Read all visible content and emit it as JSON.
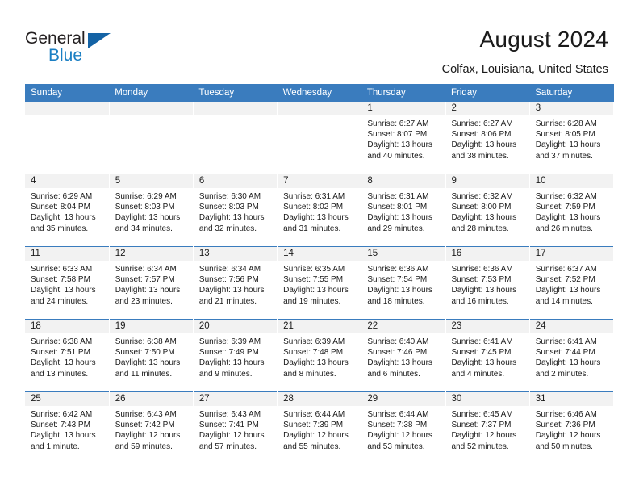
{
  "brand": {
    "name_part1": "General",
    "name_part2": "Blue",
    "logo_icon": "triangle-logo-icon"
  },
  "header": {
    "title": "August 2024",
    "subtitle": "Colfax, Louisiana, United States"
  },
  "colors": {
    "header_blue": "#3a7cbe",
    "brand_blue": "#1b7fc3",
    "logo_blue": "#1463a5",
    "daynum_band": "#f2f2f2",
    "text": "#1a1a1a"
  },
  "calendar": {
    "weekday_headers": [
      "Sunday",
      "Monday",
      "Tuesday",
      "Wednesday",
      "Thursday",
      "Friday",
      "Saturday"
    ],
    "weeks": [
      [
        {
          "empty": true
        },
        {
          "empty": true
        },
        {
          "empty": true
        },
        {
          "empty": true
        },
        {
          "day": "1",
          "sunrise": "Sunrise: 6:27 AM",
          "sunset": "Sunset: 8:07 PM",
          "daylight1": "Daylight: 13 hours",
          "daylight2": "and 40 minutes."
        },
        {
          "day": "2",
          "sunrise": "Sunrise: 6:27 AM",
          "sunset": "Sunset: 8:06 PM",
          "daylight1": "Daylight: 13 hours",
          "daylight2": "and 38 minutes."
        },
        {
          "day": "3",
          "sunrise": "Sunrise: 6:28 AM",
          "sunset": "Sunset: 8:05 PM",
          "daylight1": "Daylight: 13 hours",
          "daylight2": "and 37 minutes."
        }
      ],
      [
        {
          "day": "4",
          "sunrise": "Sunrise: 6:29 AM",
          "sunset": "Sunset: 8:04 PM",
          "daylight1": "Daylight: 13 hours",
          "daylight2": "and 35 minutes."
        },
        {
          "day": "5",
          "sunrise": "Sunrise: 6:29 AM",
          "sunset": "Sunset: 8:03 PM",
          "daylight1": "Daylight: 13 hours",
          "daylight2": "and 34 minutes."
        },
        {
          "day": "6",
          "sunrise": "Sunrise: 6:30 AM",
          "sunset": "Sunset: 8:03 PM",
          "daylight1": "Daylight: 13 hours",
          "daylight2": "and 32 minutes."
        },
        {
          "day": "7",
          "sunrise": "Sunrise: 6:31 AM",
          "sunset": "Sunset: 8:02 PM",
          "daylight1": "Daylight: 13 hours",
          "daylight2": "and 31 minutes."
        },
        {
          "day": "8",
          "sunrise": "Sunrise: 6:31 AM",
          "sunset": "Sunset: 8:01 PM",
          "daylight1": "Daylight: 13 hours",
          "daylight2": "and 29 minutes."
        },
        {
          "day": "9",
          "sunrise": "Sunrise: 6:32 AM",
          "sunset": "Sunset: 8:00 PM",
          "daylight1": "Daylight: 13 hours",
          "daylight2": "and 28 minutes."
        },
        {
          "day": "10",
          "sunrise": "Sunrise: 6:32 AM",
          "sunset": "Sunset: 7:59 PM",
          "daylight1": "Daylight: 13 hours",
          "daylight2": "and 26 minutes."
        }
      ],
      [
        {
          "day": "11",
          "sunrise": "Sunrise: 6:33 AM",
          "sunset": "Sunset: 7:58 PM",
          "daylight1": "Daylight: 13 hours",
          "daylight2": "and 24 minutes."
        },
        {
          "day": "12",
          "sunrise": "Sunrise: 6:34 AM",
          "sunset": "Sunset: 7:57 PM",
          "daylight1": "Daylight: 13 hours",
          "daylight2": "and 23 minutes."
        },
        {
          "day": "13",
          "sunrise": "Sunrise: 6:34 AM",
          "sunset": "Sunset: 7:56 PM",
          "daylight1": "Daylight: 13 hours",
          "daylight2": "and 21 minutes."
        },
        {
          "day": "14",
          "sunrise": "Sunrise: 6:35 AM",
          "sunset": "Sunset: 7:55 PM",
          "daylight1": "Daylight: 13 hours",
          "daylight2": "and 19 minutes."
        },
        {
          "day": "15",
          "sunrise": "Sunrise: 6:36 AM",
          "sunset": "Sunset: 7:54 PM",
          "daylight1": "Daylight: 13 hours",
          "daylight2": "and 18 minutes."
        },
        {
          "day": "16",
          "sunrise": "Sunrise: 6:36 AM",
          "sunset": "Sunset: 7:53 PM",
          "daylight1": "Daylight: 13 hours",
          "daylight2": "and 16 minutes."
        },
        {
          "day": "17",
          "sunrise": "Sunrise: 6:37 AM",
          "sunset": "Sunset: 7:52 PM",
          "daylight1": "Daylight: 13 hours",
          "daylight2": "and 14 minutes."
        }
      ],
      [
        {
          "day": "18",
          "sunrise": "Sunrise: 6:38 AM",
          "sunset": "Sunset: 7:51 PM",
          "daylight1": "Daylight: 13 hours",
          "daylight2": "and 13 minutes."
        },
        {
          "day": "19",
          "sunrise": "Sunrise: 6:38 AM",
          "sunset": "Sunset: 7:50 PM",
          "daylight1": "Daylight: 13 hours",
          "daylight2": "and 11 minutes."
        },
        {
          "day": "20",
          "sunrise": "Sunrise: 6:39 AM",
          "sunset": "Sunset: 7:49 PM",
          "daylight1": "Daylight: 13 hours",
          "daylight2": "and 9 minutes."
        },
        {
          "day": "21",
          "sunrise": "Sunrise: 6:39 AM",
          "sunset": "Sunset: 7:48 PM",
          "daylight1": "Daylight: 13 hours",
          "daylight2": "and 8 minutes."
        },
        {
          "day": "22",
          "sunrise": "Sunrise: 6:40 AM",
          "sunset": "Sunset: 7:46 PM",
          "daylight1": "Daylight: 13 hours",
          "daylight2": "and 6 minutes."
        },
        {
          "day": "23",
          "sunrise": "Sunrise: 6:41 AM",
          "sunset": "Sunset: 7:45 PM",
          "daylight1": "Daylight: 13 hours",
          "daylight2": "and 4 minutes."
        },
        {
          "day": "24",
          "sunrise": "Sunrise: 6:41 AM",
          "sunset": "Sunset: 7:44 PM",
          "daylight1": "Daylight: 13 hours",
          "daylight2": "and 2 minutes."
        }
      ],
      [
        {
          "day": "25",
          "sunrise": "Sunrise: 6:42 AM",
          "sunset": "Sunset: 7:43 PM",
          "daylight1": "Daylight: 13 hours",
          "daylight2": "and 1 minute."
        },
        {
          "day": "26",
          "sunrise": "Sunrise: 6:43 AM",
          "sunset": "Sunset: 7:42 PM",
          "daylight1": "Daylight: 12 hours",
          "daylight2": "and 59 minutes."
        },
        {
          "day": "27",
          "sunrise": "Sunrise: 6:43 AM",
          "sunset": "Sunset: 7:41 PM",
          "daylight1": "Daylight: 12 hours",
          "daylight2": "and 57 minutes."
        },
        {
          "day": "28",
          "sunrise": "Sunrise: 6:44 AM",
          "sunset": "Sunset: 7:39 PM",
          "daylight1": "Daylight: 12 hours",
          "daylight2": "and 55 minutes."
        },
        {
          "day": "29",
          "sunrise": "Sunrise: 6:44 AM",
          "sunset": "Sunset: 7:38 PM",
          "daylight1": "Daylight: 12 hours",
          "daylight2": "and 53 minutes."
        },
        {
          "day": "30",
          "sunrise": "Sunrise: 6:45 AM",
          "sunset": "Sunset: 7:37 PM",
          "daylight1": "Daylight: 12 hours",
          "daylight2": "and 52 minutes."
        },
        {
          "day": "31",
          "sunrise": "Sunrise: 6:46 AM",
          "sunset": "Sunset: 7:36 PM",
          "daylight1": "Daylight: 12 hours",
          "daylight2": "and 50 minutes."
        }
      ]
    ]
  }
}
